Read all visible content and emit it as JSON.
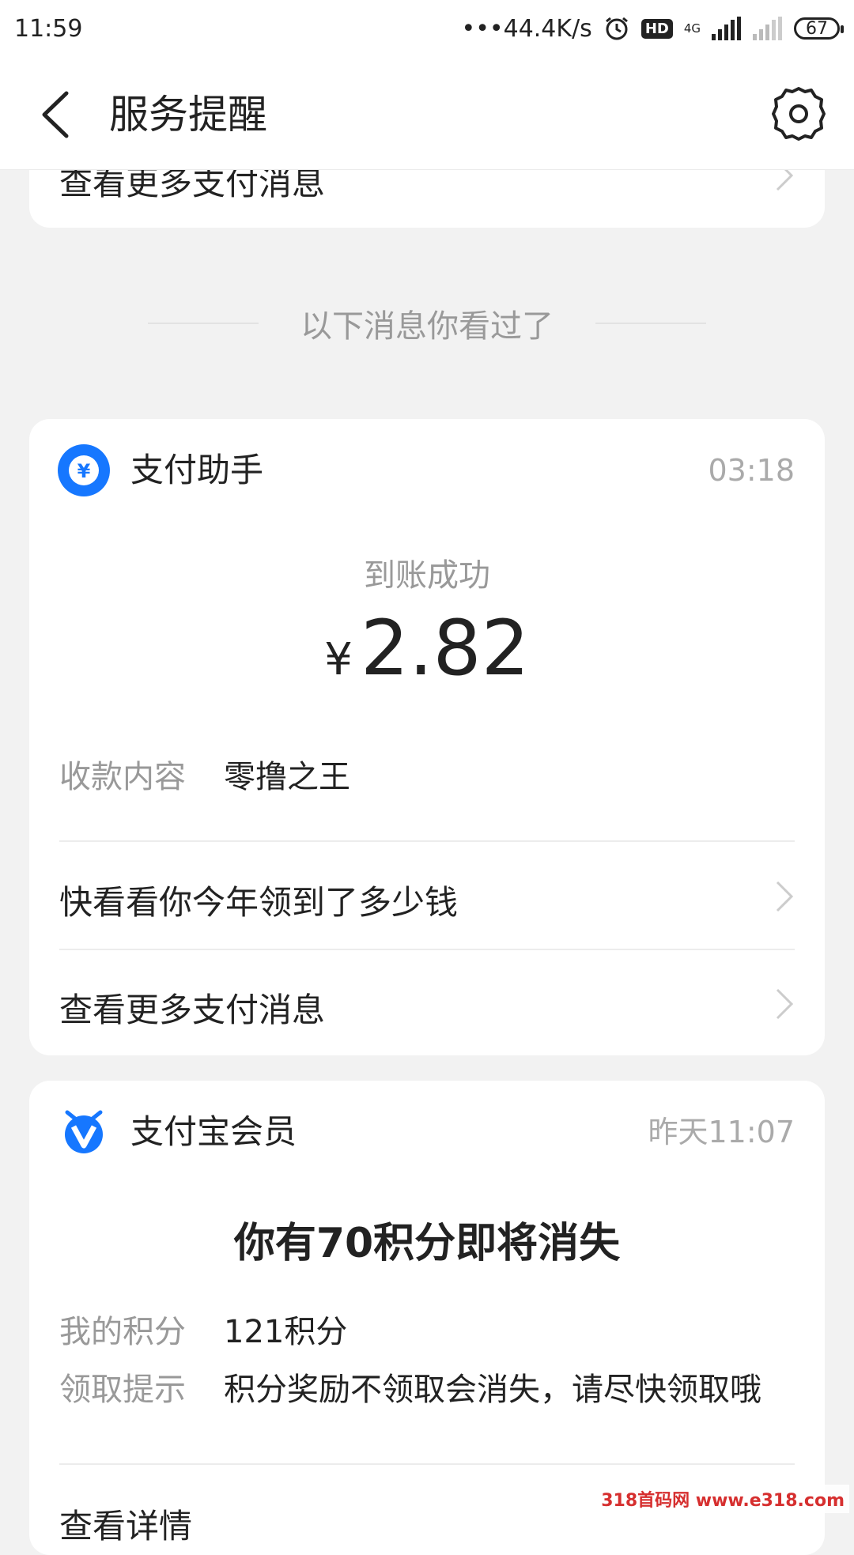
{
  "status_bar": {
    "time": "11:59",
    "speed": "•••44.4K/s",
    "hd": "HD",
    "network": "4G",
    "battery": "67"
  },
  "header": {
    "title": "服务提醒"
  },
  "top_card": {
    "link_label": "查看更多支付消息"
  },
  "divider": {
    "text": "以下消息你看过了"
  },
  "payment_card": {
    "app_name": "支付助手",
    "time": "03:18",
    "status": "到账成功",
    "currency": "¥",
    "amount": "2.82",
    "content_label": "收款内容",
    "content_value": "零撸之王",
    "link1": "快看看你今年领到了多少钱",
    "link2": "查看更多支付消息",
    "accent_color": "#1677ff"
  },
  "member_card": {
    "app_name": "支付宝会员",
    "time": "昨天11:07",
    "headline": "你有70积分即将消失",
    "points_label": "我的积分",
    "points_value": "121积分",
    "tip_label": "领取提示",
    "tip_value": "积分奖励不领取会消失，请尽快领取哦",
    "link": "查看详情"
  },
  "watermark": {
    "text": "318首码网 www.e318.com"
  }
}
